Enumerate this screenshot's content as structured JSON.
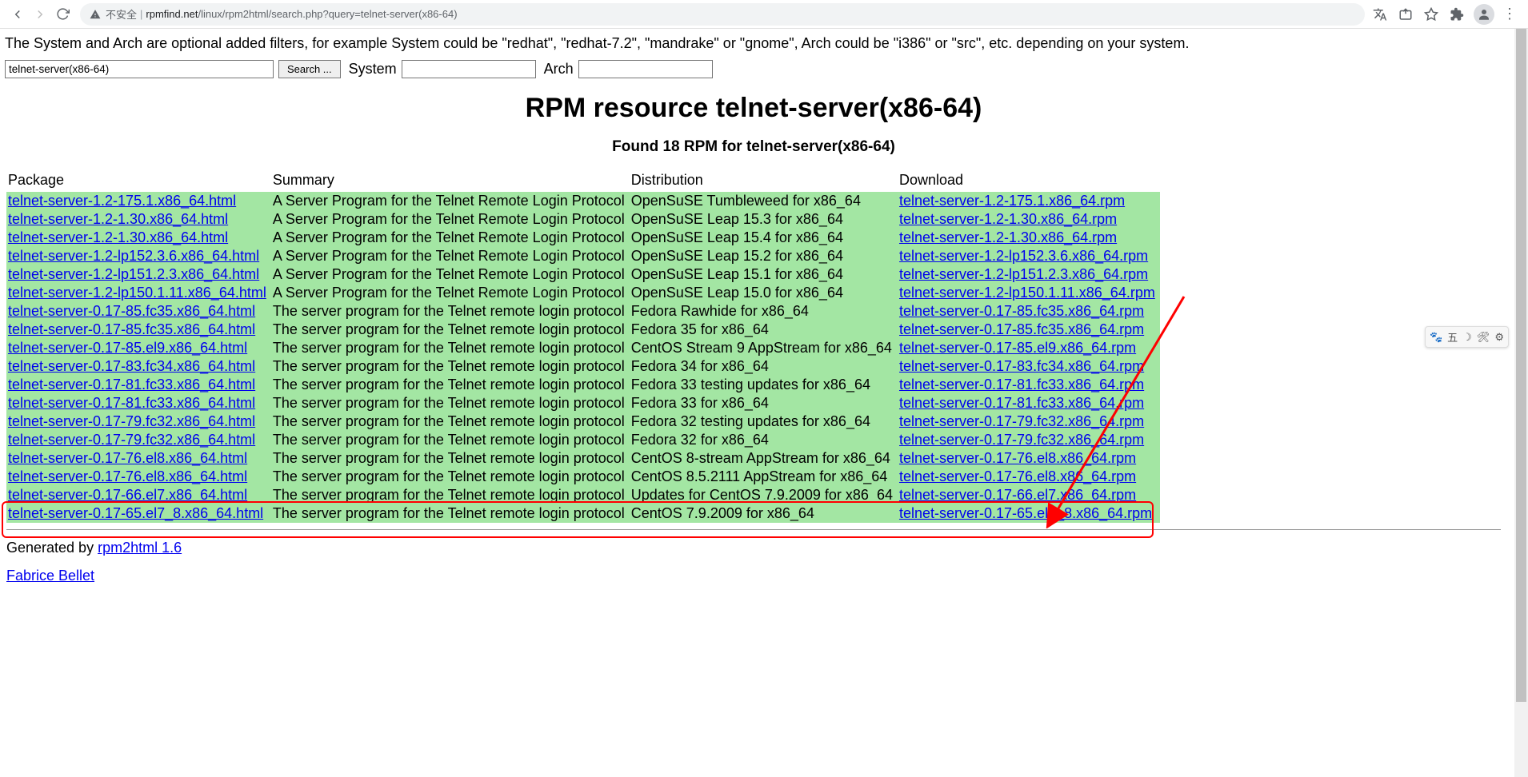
{
  "browser": {
    "insecure_label": "不安全",
    "url_host": "rpmfind.net",
    "url_path": "/linux/rpm2html/search.php?query=telnet-server(x86-64)"
  },
  "intro": "The System and Arch are optional added filters, for example System could be \"redhat\", \"redhat-7.2\", \"mandrake\" or \"gnome\", Arch could be \"i386\" or \"src\", etc. depending on your system.",
  "search": {
    "query_value": "telnet-server(x86-64)",
    "button_label": "Search ...",
    "system_label": "System",
    "arch_label": "Arch"
  },
  "title": "RPM resource telnet-server(x86-64)",
  "subtitle": "Found 18 RPM for telnet-server(x86-64)",
  "headers": {
    "package": "Package",
    "summary": "Summary",
    "distribution": "Distribution",
    "download": "Download"
  },
  "rows": [
    {
      "pkg": "telnet-server-1.2-175.1.x86_64.html",
      "sum": "A Server Program for the Telnet Remote Login Protocol",
      "dist": "OpenSuSE Tumbleweed for x86_64",
      "dl": "telnet-server-1.2-175.1.x86_64.rpm"
    },
    {
      "pkg": "telnet-server-1.2-1.30.x86_64.html",
      "sum": "A Server Program for the Telnet Remote Login Protocol",
      "dist": "OpenSuSE Leap 15.3 for x86_64",
      "dl": "telnet-server-1.2-1.30.x86_64.rpm"
    },
    {
      "pkg": "telnet-server-1.2-1.30.x86_64.html",
      "sum": "A Server Program for the Telnet Remote Login Protocol",
      "dist": "OpenSuSE Leap 15.4 for x86_64",
      "dl": "telnet-server-1.2-1.30.x86_64.rpm"
    },
    {
      "pkg": "telnet-server-1.2-lp152.3.6.x86_64.html",
      "sum": "A Server Program for the Telnet Remote Login Protocol",
      "dist": "OpenSuSE Leap 15.2 for x86_64",
      "dl": "telnet-server-1.2-lp152.3.6.x86_64.rpm"
    },
    {
      "pkg": "telnet-server-1.2-lp151.2.3.x86_64.html",
      "sum": "A Server Program for the Telnet Remote Login Protocol",
      "dist": "OpenSuSE Leap 15.1 for x86_64",
      "dl": "telnet-server-1.2-lp151.2.3.x86_64.rpm"
    },
    {
      "pkg": "telnet-server-1.2-lp150.1.11.x86_64.html",
      "sum": "A Server Program for the Telnet Remote Login Protocol",
      "dist": "OpenSuSE Leap 15.0 for x86_64",
      "dl": "telnet-server-1.2-lp150.1.11.x86_64.rpm"
    },
    {
      "pkg": "telnet-server-0.17-85.fc35.x86_64.html",
      "sum": "The server program for the Telnet remote login protocol",
      "dist": "Fedora Rawhide for x86_64",
      "dl": "telnet-server-0.17-85.fc35.x86_64.rpm"
    },
    {
      "pkg": "telnet-server-0.17-85.fc35.x86_64.html",
      "sum": "The server program for the Telnet remote login protocol",
      "dist": "Fedora 35 for x86_64",
      "dl": "telnet-server-0.17-85.fc35.x86_64.rpm"
    },
    {
      "pkg": "telnet-server-0.17-85.el9.x86_64.html",
      "sum": "The server program for the Telnet remote login protocol",
      "dist": "CentOS Stream 9 AppStream for x86_64",
      "dl": "telnet-server-0.17-85.el9.x86_64.rpm"
    },
    {
      "pkg": "telnet-server-0.17-83.fc34.x86_64.html",
      "sum": "The server program for the Telnet remote login protocol",
      "dist": "Fedora 34 for x86_64",
      "dl": "telnet-server-0.17-83.fc34.x86_64.rpm"
    },
    {
      "pkg": "telnet-server-0.17-81.fc33.x86_64.html",
      "sum": "The server program for the Telnet remote login protocol",
      "dist": "Fedora 33 testing updates for x86_64",
      "dl": "telnet-server-0.17-81.fc33.x86_64.rpm"
    },
    {
      "pkg": "telnet-server-0.17-81.fc33.x86_64.html",
      "sum": "The server program for the Telnet remote login protocol",
      "dist": "Fedora 33 for x86_64",
      "dl": "telnet-server-0.17-81.fc33.x86_64.rpm"
    },
    {
      "pkg": "telnet-server-0.17-79.fc32.x86_64.html",
      "sum": "The server program for the Telnet remote login protocol",
      "dist": "Fedora 32 testing updates for x86_64",
      "dl": "telnet-server-0.17-79.fc32.x86_64.rpm"
    },
    {
      "pkg": "telnet-server-0.17-79.fc32.x86_64.html",
      "sum": "The server program for the Telnet remote login protocol",
      "dist": "Fedora 32 for x86_64",
      "dl": "telnet-server-0.17-79.fc32.x86_64.rpm"
    },
    {
      "pkg": "telnet-server-0.17-76.el8.x86_64.html",
      "sum": "The server program for the Telnet remote login protocol",
      "dist": "CentOS 8-stream AppStream for x86_64",
      "dl": "telnet-server-0.17-76.el8.x86_64.rpm"
    },
    {
      "pkg": "telnet-server-0.17-76.el8.x86_64.html",
      "sum": "The server program for the Telnet remote login protocol",
      "dist": "CentOS 8.5.2111 AppStream for x86_64",
      "dl": "telnet-server-0.17-76.el8.x86_64.rpm"
    },
    {
      "pkg": "telnet-server-0.17-66.el7.x86_64.html",
      "sum": "The server program for the Telnet remote login protocol",
      "dist": "Updates for CentOS 7.9.2009 for x86_64",
      "dl": "telnet-server-0.17-66.el7.x86_64.rpm"
    },
    {
      "pkg": "telnet-server-0.17-65.el7_8.x86_64.html",
      "sum": "The server program for the Telnet remote login protocol",
      "dist": "CentOS 7.9.2009 for x86_64",
      "dl": "telnet-server-0.17-65.el7_8.x86_64.rpm"
    }
  ],
  "generated_prefix": "Generated by ",
  "generated_link": "rpm2html 1.6",
  "author": "Fabrice Bellet",
  "side_toolbar": {
    "item1": "五"
  }
}
